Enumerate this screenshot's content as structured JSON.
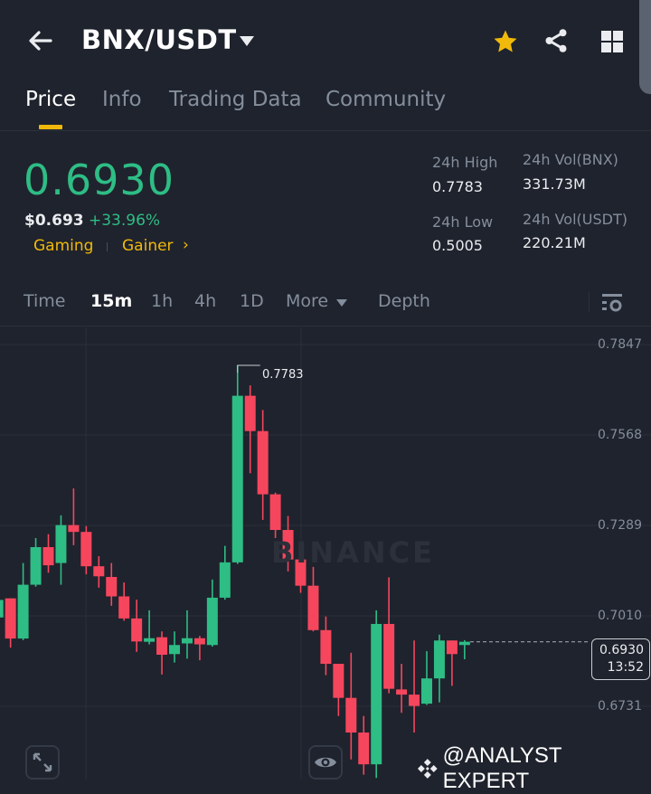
{
  "header": {
    "back_icon": "arrow-left-icon",
    "pair": "BNX/USDT",
    "icons": [
      "star-icon",
      "share-icon",
      "grid-icon"
    ]
  },
  "tabs": [
    {
      "label": "Price"
    },
    {
      "label": "Info"
    },
    {
      "label": "Trading Data"
    },
    {
      "label": "Community"
    }
  ],
  "price": {
    "last": "0.6930",
    "usd": "$0.693",
    "change": "+33.96%",
    "tags": [
      "Gaming",
      "Gainer"
    ]
  },
  "stats": {
    "high_label": "24h High",
    "high": "0.7783",
    "low_label": "24h Low",
    "low": "0.5005",
    "vol_base_label": "24h Vol(BNX)",
    "vol_base": "331.73M",
    "vol_quote_label": "24h Vol(USDT)",
    "vol_quote": "220.21M"
  },
  "intervals": {
    "time": "Time",
    "items": [
      "15m",
      "1h",
      "4h",
      "1D"
    ],
    "more": "More",
    "depth": "Depth",
    "active": "15m"
  },
  "colors": {
    "up": "#2ebd85",
    "down": "#f6465d",
    "accent": "#f0b90b",
    "bg": "#1f232d"
  },
  "chart": {
    "y_ticks": [
      "0.7847",
      "0.7568",
      "0.7289",
      "0.7010",
      "0.6731"
    ],
    "high_marker": "0.7783",
    "last_price": "0.6930",
    "countdown": "13:52",
    "watermark": "BINANCE"
  },
  "chart_data": {
    "type": "candlestick",
    "interval": "15m",
    "ylim": [
      0.646,
      0.7915
    ],
    "y_ticks": [
      0.7847,
      0.7568,
      0.7289,
      0.701,
      0.6731
    ],
    "candles": [
      [
        0.7005,
        0.7065,
        0.6995,
        0.7059
      ],
      [
        0.7064,
        0.7064,
        0.6912,
        0.694
      ],
      [
        0.694,
        0.7173,
        0.6935,
        0.7106
      ],
      [
        0.7106,
        0.725,
        0.71,
        0.7222
      ],
      [
        0.7222,
        0.7262,
        0.7143,
        0.7166
      ],
      [
        0.7173,
        0.732,
        0.7106,
        0.729
      ],
      [
        0.729,
        0.7403,
        0.7228,
        0.7269
      ],
      [
        0.7269,
        0.7287,
        0.7138,
        0.7163
      ],
      [
        0.7163,
        0.7194,
        0.7097,
        0.7132
      ],
      [
        0.713,
        0.7173,
        0.7041,
        0.707
      ],
      [
        0.707,
        0.7113,
        0.6995,
        0.7002
      ],
      [
        0.7002,
        0.706,
        0.6899,
        0.6931
      ],
      [
        0.693,
        0.7027,
        0.6922,
        0.6941
      ],
      [
        0.6944,
        0.6962,
        0.6829,
        0.689
      ],
      [
        0.6892,
        0.6962,
        0.6866,
        0.692
      ],
      [
        0.6925,
        0.7027,
        0.6878,
        0.6941
      ],
      [
        0.6941,
        0.6948,
        0.6873,
        0.6922
      ],
      [
        0.692,
        0.7122,
        0.6915,
        0.7066
      ],
      [
        0.7066,
        0.7226,
        0.706,
        0.7175
      ],
      [
        0.7175,
        0.7783,
        0.717,
        0.7689
      ],
      [
        0.7689,
        0.7721,
        0.745,
        0.758
      ],
      [
        0.758,
        0.7645,
        0.7306,
        0.7385
      ],
      [
        0.7385,
        0.739,
        0.725,
        0.7275
      ],
      [
        0.7275,
        0.7318,
        0.7147,
        0.7184
      ],
      [
        0.7184,
        0.7208,
        0.7081,
        0.7103
      ],
      [
        0.7103,
        0.7161,
        0.6962,
        0.6966
      ],
      [
        0.6966,
        0.7008,
        0.6827,
        0.6862
      ],
      [
        0.6862,
        0.6862,
        0.6701,
        0.6757
      ],
      [
        0.6757,
        0.6896,
        0.6567,
        0.665
      ],
      [
        0.665,
        0.6701,
        0.652,
        0.6552
      ],
      [
        0.6552,
        0.7027,
        0.651,
        0.6985
      ],
      [
        0.6985,
        0.7129,
        0.6771,
        0.6785
      ],
      [
        0.6783,
        0.6862,
        0.6711,
        0.6767
      ],
      [
        0.6767,
        0.6934,
        0.665,
        0.6732
      ],
      [
        0.6739,
        0.6901,
        0.6735,
        0.6817
      ],
      [
        0.6817,
        0.6952,
        0.6743,
        0.6934
      ],
      [
        0.6934,
        0.6934,
        0.6794,
        0.6892
      ],
      [
        0.692,
        0.6935,
        0.6876,
        0.693
      ]
    ]
  },
  "footer": {
    "expand_icon": "expand-icon",
    "eye_icon": "eye-icon",
    "credit": "@ANALYST EXPERT"
  }
}
